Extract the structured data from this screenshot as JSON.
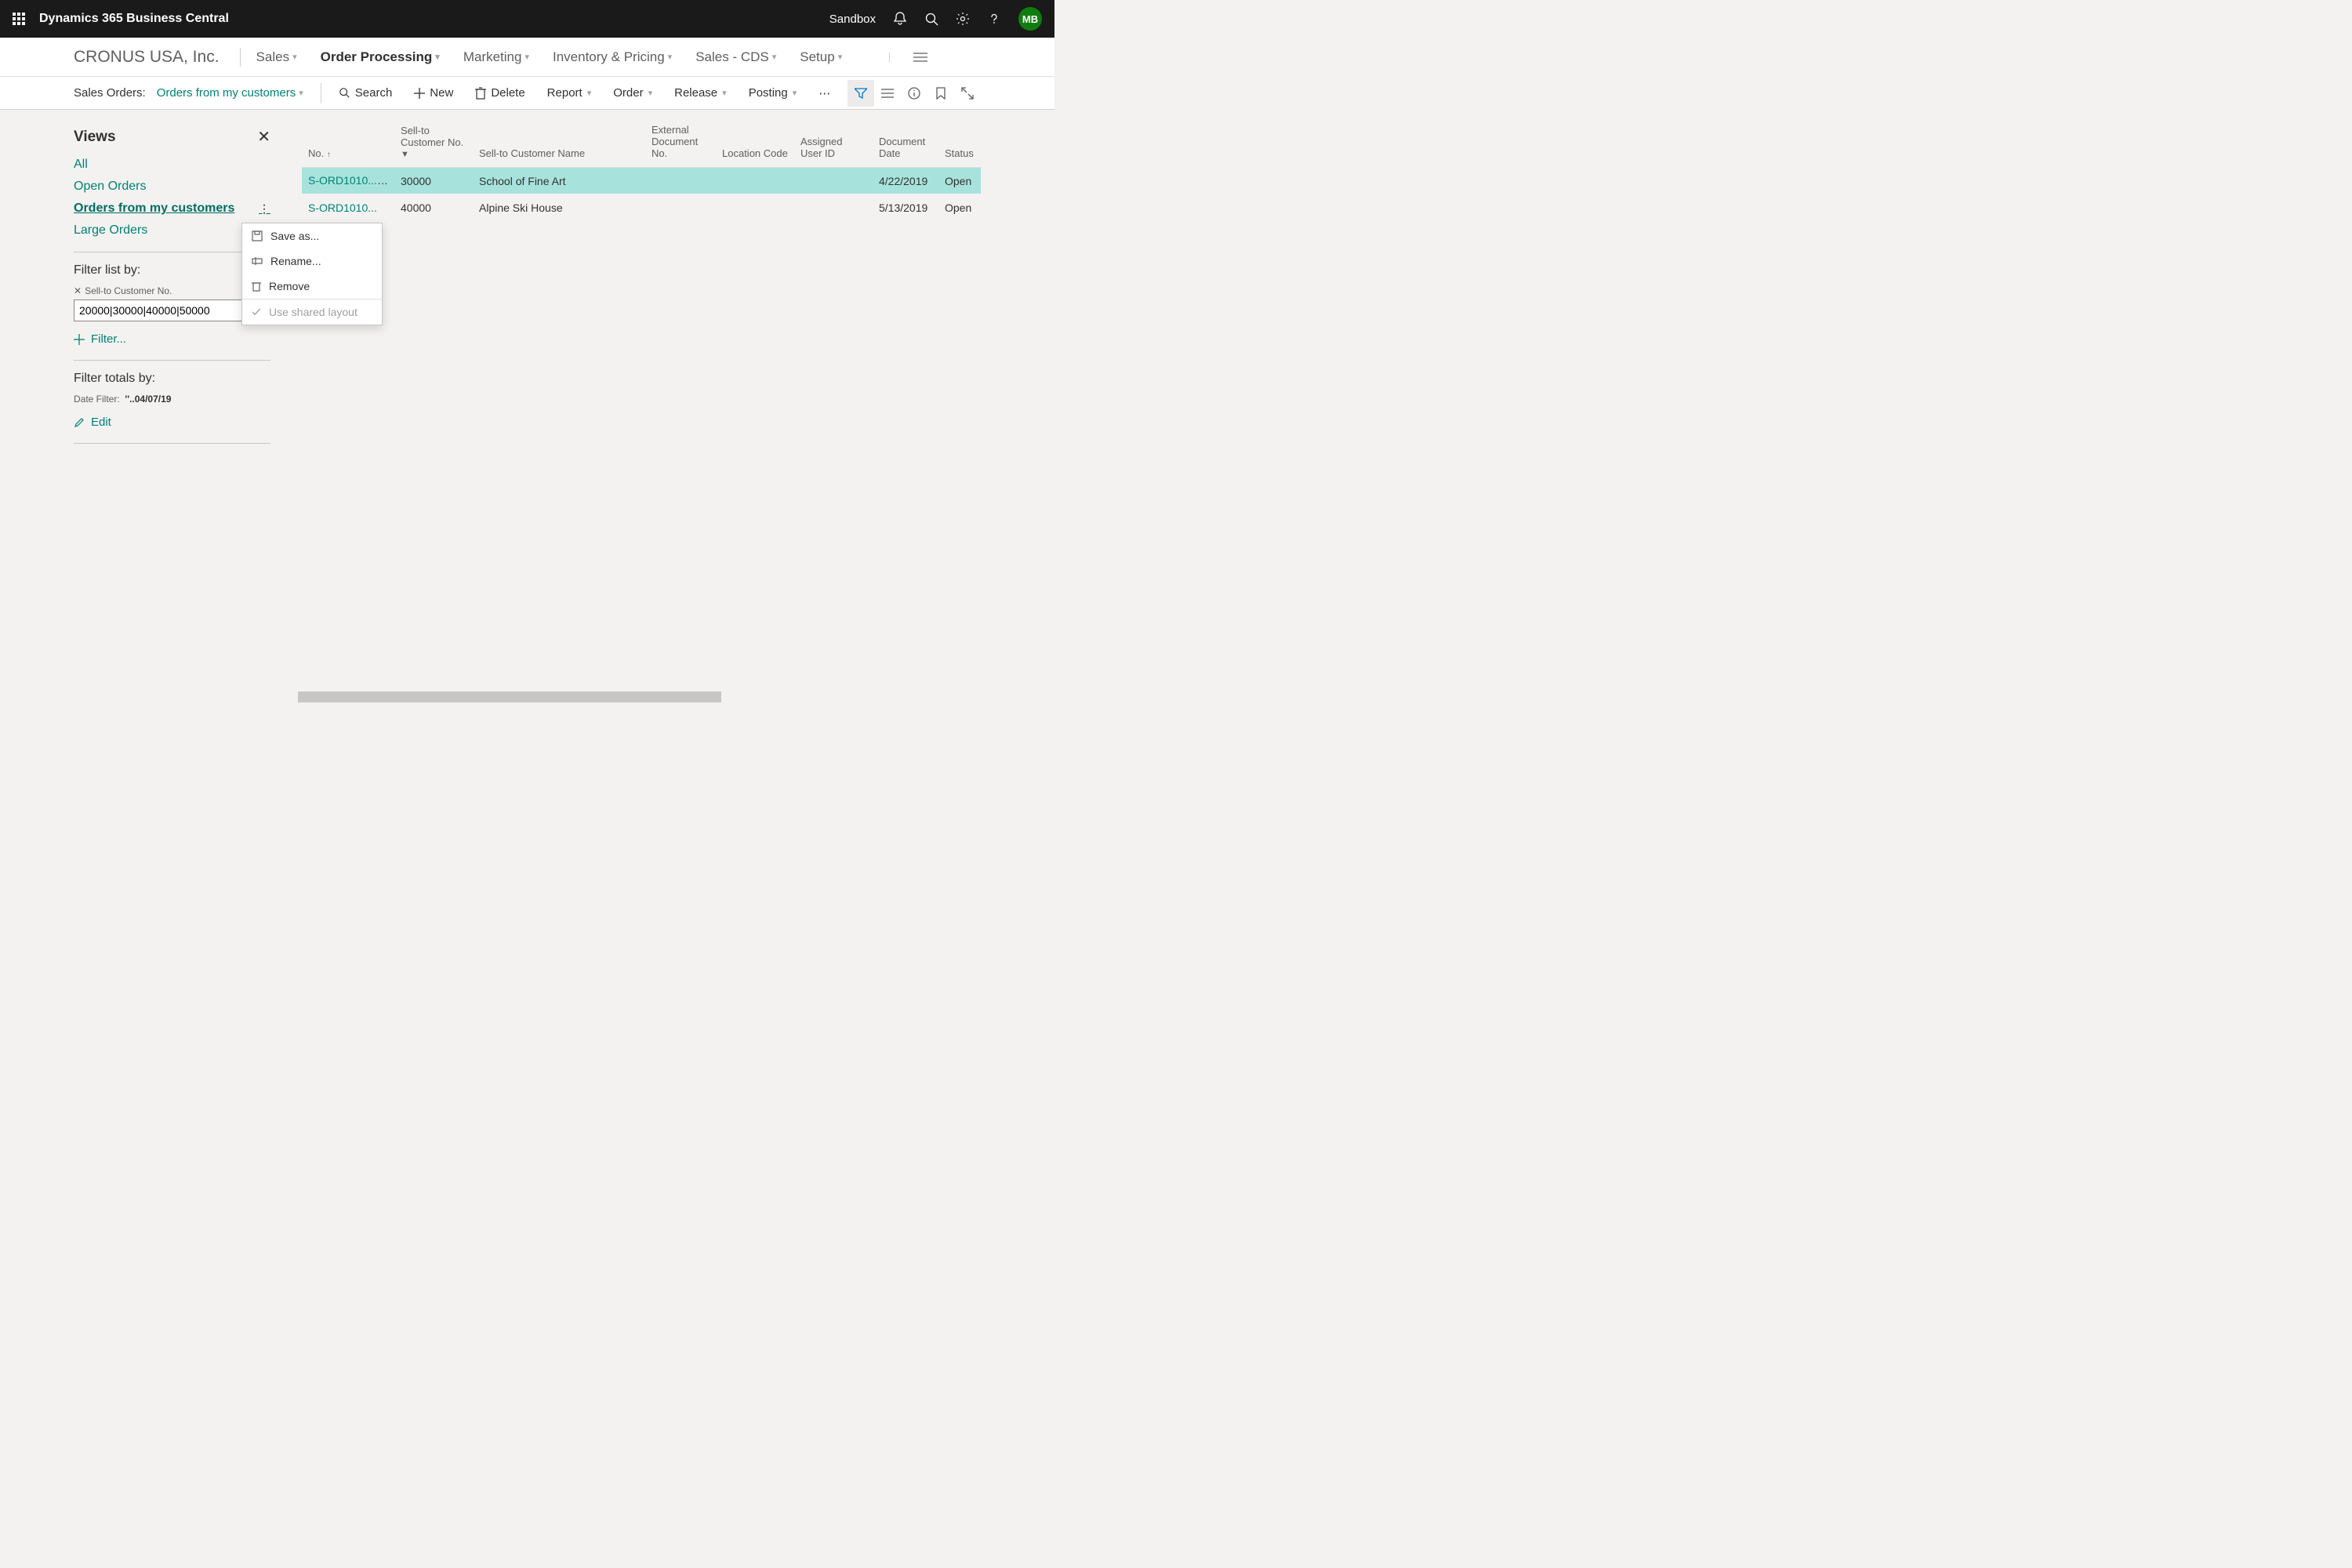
{
  "topbar": {
    "product": "Dynamics 365 Business Central",
    "env": "Sandbox",
    "avatar": "MB"
  },
  "nav": {
    "company": "CRONUS USA, Inc.",
    "tabs": [
      "Sales",
      "Order Processing",
      "Marketing",
      "Inventory & Pricing",
      "Sales - CDS",
      "Setup"
    ],
    "active": "Order Processing"
  },
  "toolbar": {
    "page_label": "Sales Orders:",
    "view_selected": "Orders from my customers",
    "search": "Search",
    "new": "New",
    "delete": "Delete",
    "report": "Report",
    "order": "Order",
    "release": "Release",
    "posting": "Posting"
  },
  "views": {
    "heading": "Views",
    "items": [
      "All",
      "Open Orders",
      "Orders from my customers",
      "Large Orders"
    ],
    "selected": "Orders from my customers"
  },
  "filter": {
    "listby_label": "Filter list by:",
    "field_label": "Sell-to Customer No.",
    "value": "20000|30000|40000|50000",
    "addfilter": "Filter...",
    "totalsby_label": "Filter totals by:",
    "date_label": "Date Filter:",
    "date_value": "''..04/07/19",
    "edit": "Edit"
  },
  "ctx": {
    "saveas": "Save as...",
    "rename": "Rename...",
    "remove": "Remove",
    "shared": "Use shared layout"
  },
  "grid": {
    "cols": {
      "no": "No.",
      "cust": "Sell-to Customer No.",
      "name": "Sell-to Customer Name",
      "ext": "External Document No.",
      "loc": "Location Code",
      "aid": "Assigned User ID",
      "date": "Document Date",
      "status": "Status"
    },
    "rows": [
      {
        "no": "S-ORD1010...",
        "cust": "30000",
        "name": "School of Fine Art",
        "ext": "",
        "loc": "",
        "aid": "",
        "date": "4/22/2019",
        "status": "Open",
        "selected": true
      },
      {
        "no": "S-ORD1010...",
        "cust": "40000",
        "name": "Alpine Ski House",
        "ext": "",
        "loc": "",
        "aid": "",
        "date": "5/13/2019",
        "status": "Open",
        "selected": false
      }
    ]
  }
}
